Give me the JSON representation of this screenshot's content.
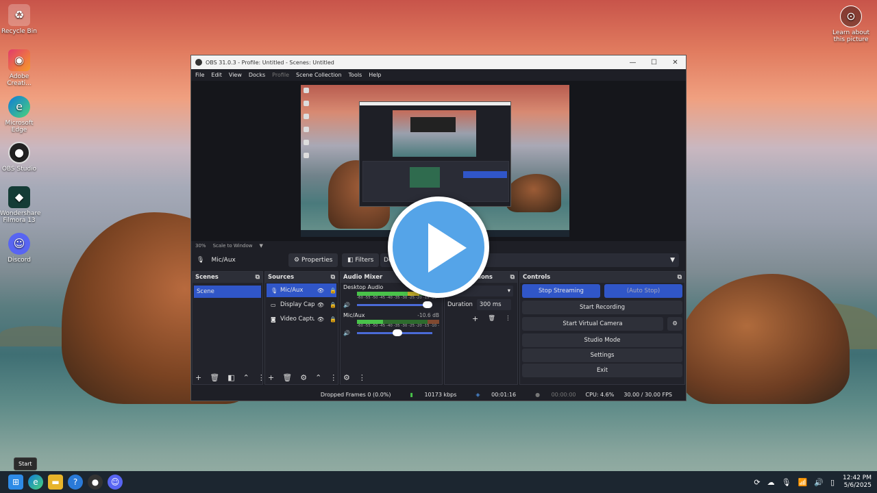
{
  "desktop": {
    "icons": [
      {
        "label": "Recycle Bin"
      },
      {
        "label": "Adobe Creati..."
      },
      {
        "label": "Microsoft Edge"
      },
      {
        "label": "OBS Studio"
      },
      {
        "label": "Wondershare Filmora 13"
      },
      {
        "label": "Discord"
      }
    ],
    "learn_picture": "Learn about this picture"
  },
  "obs": {
    "title": "OBS 31.0.3 - Profile: Untitled - Scenes: Untitled",
    "menu": [
      "File",
      "Edit",
      "View",
      "Docks",
      "Profile",
      "Scene Collection",
      "Tools",
      "Help"
    ],
    "zoom": "30%",
    "scale_mode": "Scale to Window",
    "source_bar": {
      "selected": "Mic/Aux",
      "properties": "Properties",
      "filters": "Filters",
      "device_prefix": "De"
    },
    "docks": {
      "scenes": {
        "title": "Scenes",
        "items": [
          "Scene"
        ]
      },
      "sources": {
        "title": "Sources",
        "items": [
          "Mic/Aux",
          "Display Cap",
          "Video Captu"
        ]
      },
      "mixer": {
        "title": "Audio Mixer",
        "channels": [
          {
            "name": "Desktop Audio",
            "db": "",
            "level": 0.62,
            "volume": 1.0
          },
          {
            "name": "Mic/Aux",
            "db": "-10.6 dB",
            "level": 0.32,
            "volume": 0.6
          }
        ],
        "ticks": "-60 -55 -50 -45 -40 -35 -30 -25 -20 -15 -10 -5 0"
      },
      "transitions": {
        "title": "Transitions",
        "title_visible": "sitions",
        "mode": "ade",
        "duration_label": "Duration",
        "duration": "300 ms"
      },
      "controls": {
        "title": "Controls",
        "stop_streaming": "Stop Streaming",
        "auto_stop": "(Auto Stop)",
        "start_recording": "Start Recording",
        "start_virtual_camera": "Start Virtual Camera",
        "studio_mode": "Studio Mode",
        "settings": "Settings",
        "exit": "Exit"
      }
    },
    "status": {
      "dropped": "Dropped Frames 0 (0.0%)",
      "bitrate": "10173 kbps",
      "stream_time": "00:01:16",
      "rec_time": "00:00:00",
      "cpu": "CPU: 4.6%",
      "fps": "30.00 / 30.00 FPS"
    }
  },
  "taskbar": {
    "start_tooltip": "Start",
    "time": "12:42 PM",
    "date": "5/6/2025"
  },
  "colors": {
    "accent": "#3056c8",
    "play": "#55a4e8"
  }
}
